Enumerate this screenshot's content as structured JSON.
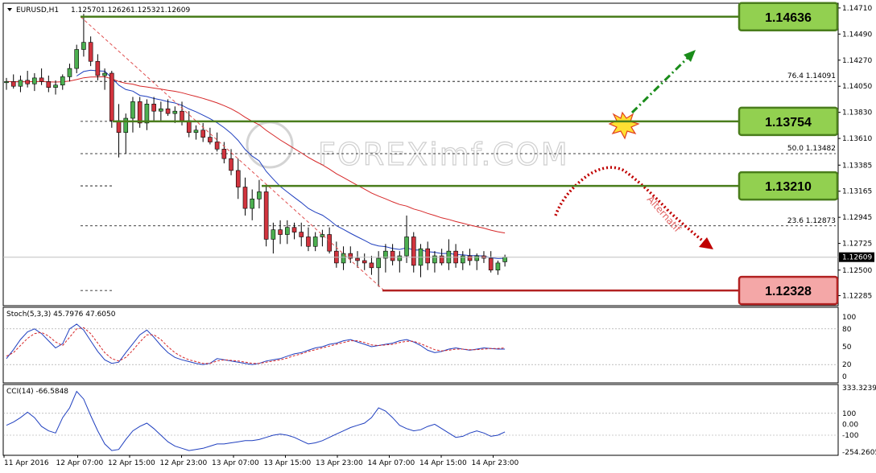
{
  "chart_data": [
    {
      "type": "candlestick",
      "title": "EURUSD,H1",
      "ohlc_header": [
        "1.12570",
        "1.12626",
        "1.12532",
        "1.12609"
      ],
      "ylim": [
        1.122,
        1.1475
      ],
      "y_ticks": [
        "1.14710",
        "1.14490",
        "1.14270",
        "1.14050",
        "1.13830",
        "1.13610",
        "1.13385",
        "1.13165",
        "1.12945",
        "1.12725",
        "1.12500",
        "1.12285"
      ],
      "current_price": "1.12609",
      "x_ticks": [
        "11 Apr 2016",
        "12 Apr 07:00",
        "12 Apr 15:00",
        "12 Apr 23:00",
        "13 Apr 07:00",
        "13 Apr 15:00",
        "13 Apr 23:00",
        "14 Apr 07:00",
        "14 Apr 15:00",
        "14 Apr 23:00"
      ],
      "levels": [
        {
          "label": "1.14636",
          "value": 1.14636,
          "color": "#92d050",
          "kind": "resistance"
        },
        {
          "label": "1.13754",
          "value": 1.13754,
          "color": "#92d050",
          "kind": "resistance"
        },
        {
          "label": "1.13210",
          "value": 1.1321,
          "color": "#92d050",
          "kind": "resistance"
        },
        {
          "label": "1.12328",
          "value": 1.12328,
          "color": "#f4a7a7",
          "kind": "support"
        }
      ],
      "fibo": [
        {
          "label": "76.4  1.14091",
          "value": 1.14091
        },
        {
          "label": "50.0  1.13482",
          "value": 1.13482
        },
        {
          "label": "23.6  1.12873",
          "value": 1.12873
        }
      ],
      "annotation": "Alternatif",
      "watermark": "FOREXimf.COM",
      "candles": [
        [
          1.1408,
          1.1412,
          1.1402,
          1.1409
        ],
        [
          1.1409,
          1.1415,
          1.1403,
          1.1405
        ],
        [
          1.1405,
          1.1414,
          1.14,
          1.141
        ],
        [
          1.141,
          1.1418,
          1.1404,
          1.1407
        ],
        [
          1.1407,
          1.1416,
          1.1401,
          1.1412
        ],
        [
          1.1412,
          1.142,
          1.1406,
          1.1409
        ],
        [
          1.1409,
          1.1414,
          1.14,
          1.1404
        ],
        [
          1.1404,
          1.141,
          1.1398,
          1.1406
        ],
        [
          1.1406,
          1.1415,
          1.1402,
          1.1413
        ],
        [
          1.1413,
          1.1424,
          1.1409,
          1.142
        ],
        [
          1.142,
          1.144,
          1.1416,
          1.1436
        ],
        [
          1.1436,
          1.1466,
          1.143,
          1.1442
        ],
        [
          1.1442,
          1.1447,
          1.1422,
          1.1426
        ],
        [
          1.1426,
          1.1432,
          1.141,
          1.1414
        ],
        [
          1.1414,
          1.142,
          1.1402,
          1.1416
        ],
        [
          1.1416,
          1.1418,
          1.137,
          1.1376
        ],
        [
          1.1376,
          1.139,
          1.1345,
          1.1366
        ],
        [
          1.1366,
          1.1382,
          1.1348,
          1.1378
        ],
        [
          1.1378,
          1.1396,
          1.1366,
          1.1392
        ],
        [
          1.1392,
          1.1396,
          1.137,
          1.1374
        ],
        [
          1.1374,
          1.1394,
          1.1368,
          1.139
        ],
        [
          1.139,
          1.1396,
          1.1376,
          1.1384
        ],
        [
          1.1384,
          1.1392,
          1.1376,
          1.1386
        ],
        [
          1.1386,
          1.1394,
          1.138,
          1.1382
        ],
        [
          1.1382,
          1.1388,
          1.1374,
          1.1384
        ],
        [
          1.1384,
          1.1392,
          1.1372,
          1.1376
        ],
        [
          1.1376,
          1.1384,
          1.1362,
          1.1366
        ],
        [
          1.1366,
          1.1372,
          1.136,
          1.1368
        ],
        [
          1.1368,
          1.1374,
          1.1358,
          1.1362
        ],
        [
          1.1362,
          1.137,
          1.1356,
          1.1358
        ],
        [
          1.1358,
          1.1366,
          1.135,
          1.1352
        ],
        [
          1.1352,
          1.1358,
          1.134,
          1.1344
        ],
        [
          1.1344,
          1.1352,
          1.133,
          1.1334
        ],
        [
          1.1334,
          1.1344,
          1.131,
          1.132
        ],
        [
          1.132,
          1.1328,
          1.1296,
          1.1302
        ],
        [
          1.1302,
          1.1318,
          1.1292,
          1.131
        ],
        [
          1.131,
          1.1326,
          1.1302,
          1.1316
        ],
        [
          1.1316,
          1.1322,
          1.127,
          1.1276
        ],
        [
          1.1276,
          1.129,
          1.1264,
          1.1284
        ],
        [
          1.1284,
          1.1292,
          1.1272,
          1.128
        ],
        [
          1.128,
          1.1292,
          1.1272,
          1.1286
        ],
        [
          1.1286,
          1.129,
          1.1276,
          1.1282
        ],
        [
          1.1282,
          1.129,
          1.127,
          1.1278
        ],
        [
          1.1278,
          1.1286,
          1.1266,
          1.127
        ],
        [
          1.127,
          1.1282,
          1.1266,
          1.1278
        ],
        [
          1.1278,
          1.1284,
          1.127,
          1.128
        ],
        [
          1.128,
          1.1286,
          1.1264,
          1.1266
        ],
        [
          1.1266,
          1.1274,
          1.1252,
          1.1256
        ],
        [
          1.1256,
          1.127,
          1.125,
          1.1264
        ],
        [
          1.1264,
          1.127,
          1.1256,
          1.126
        ],
        [
          1.126,
          1.1266,
          1.1252,
          1.1258
        ],
        [
          1.1258,
          1.1264,
          1.125,
          1.1256
        ],
        [
          1.1256,
          1.1262,
          1.1246,
          1.1252
        ],
        [
          1.1252,
          1.1266,
          1.1236,
          1.126
        ],
        [
          1.126,
          1.1272,
          1.1248,
          1.1266
        ],
        [
          1.1266,
          1.1272,
          1.1254,
          1.1258
        ],
        [
          1.1258,
          1.1266,
          1.1248,
          1.1262
        ],
        [
          1.1262,
          1.1296,
          1.1256,
          1.1278
        ],
        [
          1.1278,
          1.1282,
          1.1248,
          1.1254
        ],
        [
          1.1254,
          1.1272,
          1.1244,
          1.1268
        ],
        [
          1.1268,
          1.1274,
          1.125,
          1.1256
        ],
        [
          1.1256,
          1.1266,
          1.1248,
          1.1262
        ],
        [
          1.1262,
          1.1268,
          1.1254,
          1.1256
        ],
        [
          1.1256,
          1.1276,
          1.125,
          1.1266
        ],
        [
          1.1266,
          1.1272,
          1.1252,
          1.1256
        ],
        [
          1.1256,
          1.1266,
          1.125,
          1.1262
        ],
        [
          1.1262,
          1.1268,
          1.1254,
          1.1258
        ],
        [
          1.1258,
          1.1264,
          1.125,
          1.1262
        ],
        [
          1.1262,
          1.1266,
          1.1256,
          1.126
        ],
        [
          1.126,
          1.1266,
          1.1248,
          1.125
        ],
        [
          1.125,
          1.1258,
          1.1246,
          1.1256
        ],
        [
          1.1257,
          1.1263,
          1.1253,
          1.1261
        ]
      ]
    },
    {
      "type": "line",
      "title": "Stoch(5,3,3) 45.7976 47.6050",
      "ylim": [
        0,
        100
      ],
      "y_ticks": [
        "100",
        "80",
        "50",
        "20",
        "0"
      ],
      "series": [
        {
          "values": [
            30,
            45,
            62,
            75,
            80,
            72,
            60,
            48,
            55,
            80,
            88,
            78,
            60,
            42,
            28,
            22,
            24,
            40,
            55,
            70,
            78,
            66,
            52,
            40,
            32,
            28,
            25,
            22,
            20,
            22,
            30,
            28,
            26,
            24,
            22,
            20,
            22,
            26,
            28,
            30,
            34,
            38,
            40,
            44,
            48,
            50,
            54,
            56,
            60,
            62,
            58,
            54,
            50,
            52,
            54,
            56,
            60,
            62,
            58,
            52,
            44,
            40,
            42,
            46,
            48,
            46,
            44,
            46,
            48,
            47,
            46,
            46
          ]
        },
        {
          "values": [
            34,
            40,
            52,
            64,
            72,
            74,
            68,
            58,
            52,
            66,
            80,
            82,
            72,
            56,
            40,
            30,
            26,
            32,
            44,
            58,
            70,
            70,
            62,
            50,
            40,
            33,
            28,
            25,
            22,
            22,
            26,
            28,
            27,
            26,
            24,
            22,
            22,
            24,
            26,
            28,
            31,
            35,
            38,
            42,
            45,
            48,
            51,
            54,
            57,
            60,
            60,
            57,
            53,
            52,
            53,
            54,
            57,
            59,
            59,
            55,
            50,
            45,
            43,
            44,
            46,
            46,
            45,
            45,
            46,
            47,
            47,
            48
          ]
        }
      ]
    },
    {
      "type": "line",
      "title": "CCI(14) -66.5848",
      "ylim": [
        -254.2605,
        333.3239
      ],
      "y_ticks": [
        "333.3239",
        "100",
        "0.00",
        "-100",
        "-254.2605"
      ],
      "series": [
        {
          "values": [
            -10,
            20,
            60,
            110,
            60,
            -20,
            -60,
            -80,
            60,
            150,
            300,
            230,
            80,
            -60,
            -180,
            -240,
            -230,
            -140,
            -60,
            -20,
            10,
            -40,
            -100,
            -160,
            -200,
            -220,
            -240,
            -230,
            -220,
            -200,
            -180,
            -180,
            -170,
            -160,
            -150,
            -150,
            -140,
            -120,
            -100,
            -90,
            -100,
            -120,
            -150,
            -180,
            -170,
            -150,
            -120,
            -90,
            -60,
            -30,
            -10,
            10,
            60,
            150,
            120,
            60,
            -10,
            -40,
            -60,
            -50,
            -20,
            0,
            -40,
            -80,
            -120,
            -110,
            -80,
            -60,
            -80,
            -110,
            -100,
            -70
          ]
        }
      ]
    }
  ]
}
